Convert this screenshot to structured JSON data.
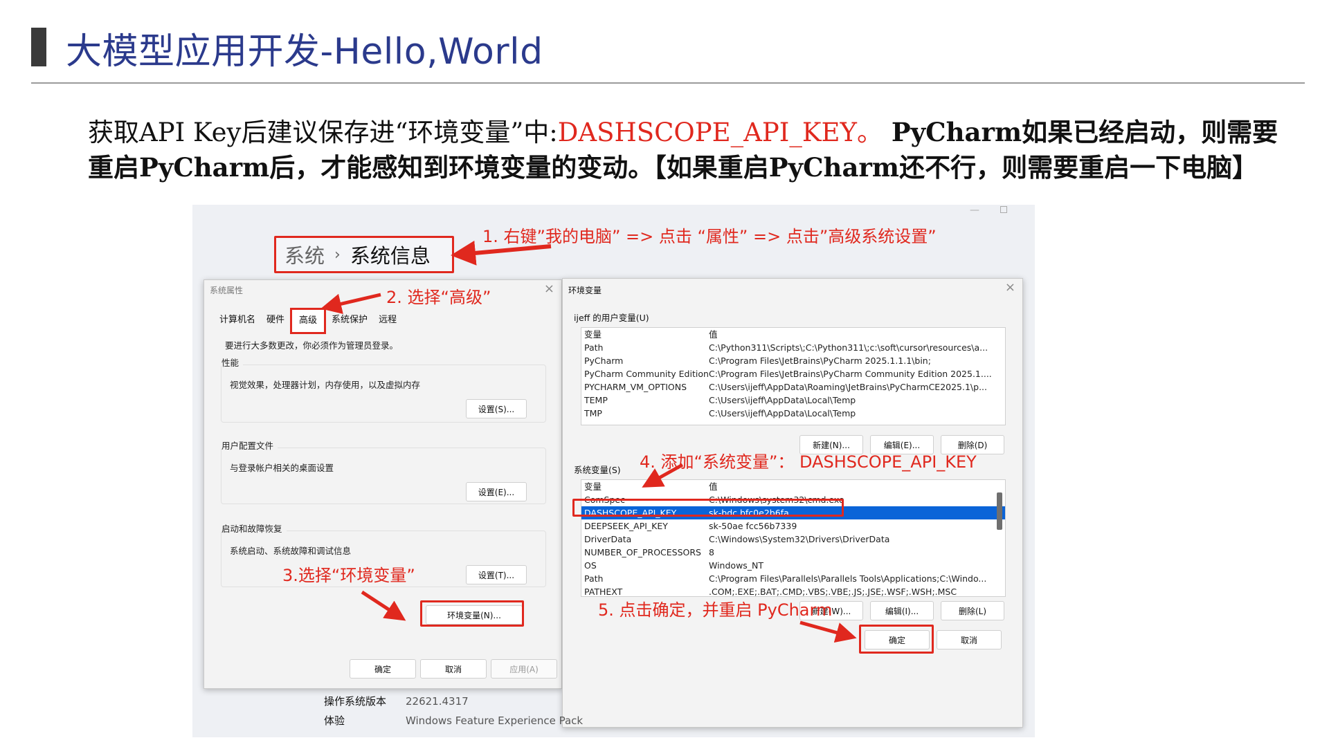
{
  "slide": {
    "title": "大模型应用开发-Hello,World",
    "intro_a": "获取API Key后建议保存进“环境变量”中:",
    "intro_key": "DASHSCOPE_API_KEY。",
    "intro_b": " PyCharm如果已经启动，则需要重启PyCharm后，才能感知到环境变量的变动。【如果重启PyCharm还不行，则需要重启一下电脑】"
  },
  "breadcrumb": {
    "parent": "系统",
    "separator": "›",
    "current": "系统信息"
  },
  "annotations": {
    "step1": "1. 右键”我的电脑” => 点击 “属性” => 点击”高级系统设置”",
    "step2": "2. 选择“高级”",
    "step3": "3.选择“环境变量”",
    "step4": "4. 添加“系统变量”： DASHSCOPE_API_KEY",
    "step5": "5. 点击确定，并重启 PyCharm"
  },
  "sysprop": {
    "title": "系统属性",
    "tabs": [
      "计算机名",
      "硬件",
      "高级",
      "系统保护",
      "远程"
    ],
    "note": "要进行大多数更改，你必须作为管理员登录。",
    "perf_label": "性能",
    "perf_desc": "视觉效果，处理器计划，内存使用，以及虚拟内存",
    "perf_btn": "设置(S)...",
    "profile_label": "用户配置文件",
    "profile_desc": "与登录帐户相关的桌面设置",
    "profile_btn": "设置(E)...",
    "startup_label": "启动和故障恢复",
    "startup_desc": "系统启动、系统故障和调试信息",
    "startup_btn": "设置(T)...",
    "envvar_btn": "环境变量(N)...",
    "ok": "确定",
    "cancel": "取消",
    "apply": "应用(A)"
  },
  "envdlg": {
    "title": "环境变量",
    "user_label": "ijeff 的用户变量(U)",
    "col_var": "变量",
    "col_val": "值",
    "user_vars": [
      [
        "Path",
        "C:\\Python311\\Scripts\\;C:\\Python311\\;c:\\soft\\cursor\\resources\\a..."
      ],
      [
        "PyCharm",
        "C:\\Program Files\\JetBrains\\PyCharm 2025.1.1.1\\bin;"
      ],
      [
        "PyCharm Community Edition",
        "C:\\Program Files\\JetBrains\\PyCharm Community Edition 2025.1...."
      ],
      [
        "PYCHARM_VM_OPTIONS",
        "C:\\Users\\ijeff\\AppData\\Roaming\\JetBrains\\PyCharmCE2025.1\\p..."
      ],
      [
        "TEMP",
        "C:\\Users\\ijeff\\AppData\\Local\\Temp"
      ],
      [
        "TMP",
        "C:\\Users\\ijeff\\AppData\\Local\\Temp"
      ]
    ],
    "new_user": "新建(N)...",
    "edit_user": "编辑(E)...",
    "delete_user": "删除(D)",
    "sys_label": "系统变量(S)",
    "sys_vars": [
      [
        "ComSpec",
        "C:\\Windows\\system32\\cmd.exe"
      ],
      [
        "DASHSCOPE_API_KEY",
        "sk-bdc                          bfc0e2b6fa"
      ],
      [
        "DEEPSEEK_API_KEY",
        "sk-50ae                         fcc56b7339"
      ],
      [
        "DriverData",
        "C:\\Windows\\System32\\Drivers\\DriverData"
      ],
      [
        "NUMBER_OF_PROCESSORS",
        "8"
      ],
      [
        "OS",
        "Windows_NT"
      ],
      [
        "Path",
        "C:\\Program Files\\Parallels\\Parallels Tools\\Applications;C:\\Windo..."
      ],
      [
        "PATHEXT",
        ".COM;.EXE;.BAT;.CMD;.VBS;.VBE;.JS;.JSE;.WSF;.WSH;.MSC"
      ]
    ],
    "new_sys": "新建(W)...",
    "edit_sys": "编辑(I)...",
    "delete_sys": "删除(L)",
    "ok": "确定",
    "cancel": "取消"
  },
  "sysinfo": {
    "os_build_label": "操作系统版本",
    "os_build_value": "22621.4317",
    "experience_label": "体验",
    "experience_value": "Windows Feature Experience Pack"
  },
  "colors": {
    "accent_red": "#e0281e",
    "title_blue": "#2b3a8c",
    "selection_blue": "#0a64d8"
  }
}
